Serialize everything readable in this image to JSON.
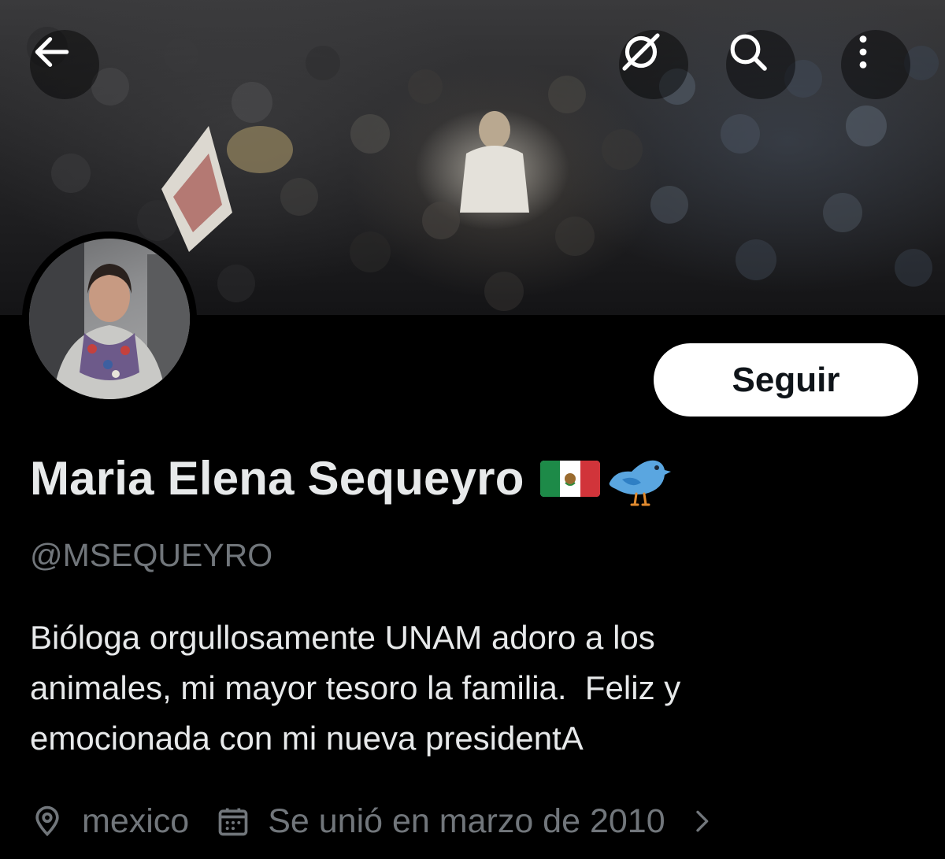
{
  "header": {
    "back_icon": "arrow-left-icon",
    "grok_icon": "grok-icon",
    "search_icon": "search-icon",
    "more_icon": "more-vertical-icon"
  },
  "profile": {
    "display_name": "Maria Elena Sequeyro",
    "name_emojis": [
      "mexico-flag-icon",
      "bird-icon"
    ],
    "handle": "@MSEQUEYRO",
    "follow_label": "Seguir",
    "bio_lines": [
      "Bióloga orgullosamente UNAM adoro a los",
      "animales, mi mayor tesoro la familia.  Feliz y",
      "emocionada con mi nueva presidentA"
    ],
    "location": "mexico",
    "joined": "Se unió en marzo de 2010"
  },
  "colors": {
    "background": "#000000",
    "primary_text": "#e7e9ea",
    "secondary_text": "#71767b",
    "follow_button_bg": "#ffffff",
    "follow_button_text": "#0f1419"
  }
}
